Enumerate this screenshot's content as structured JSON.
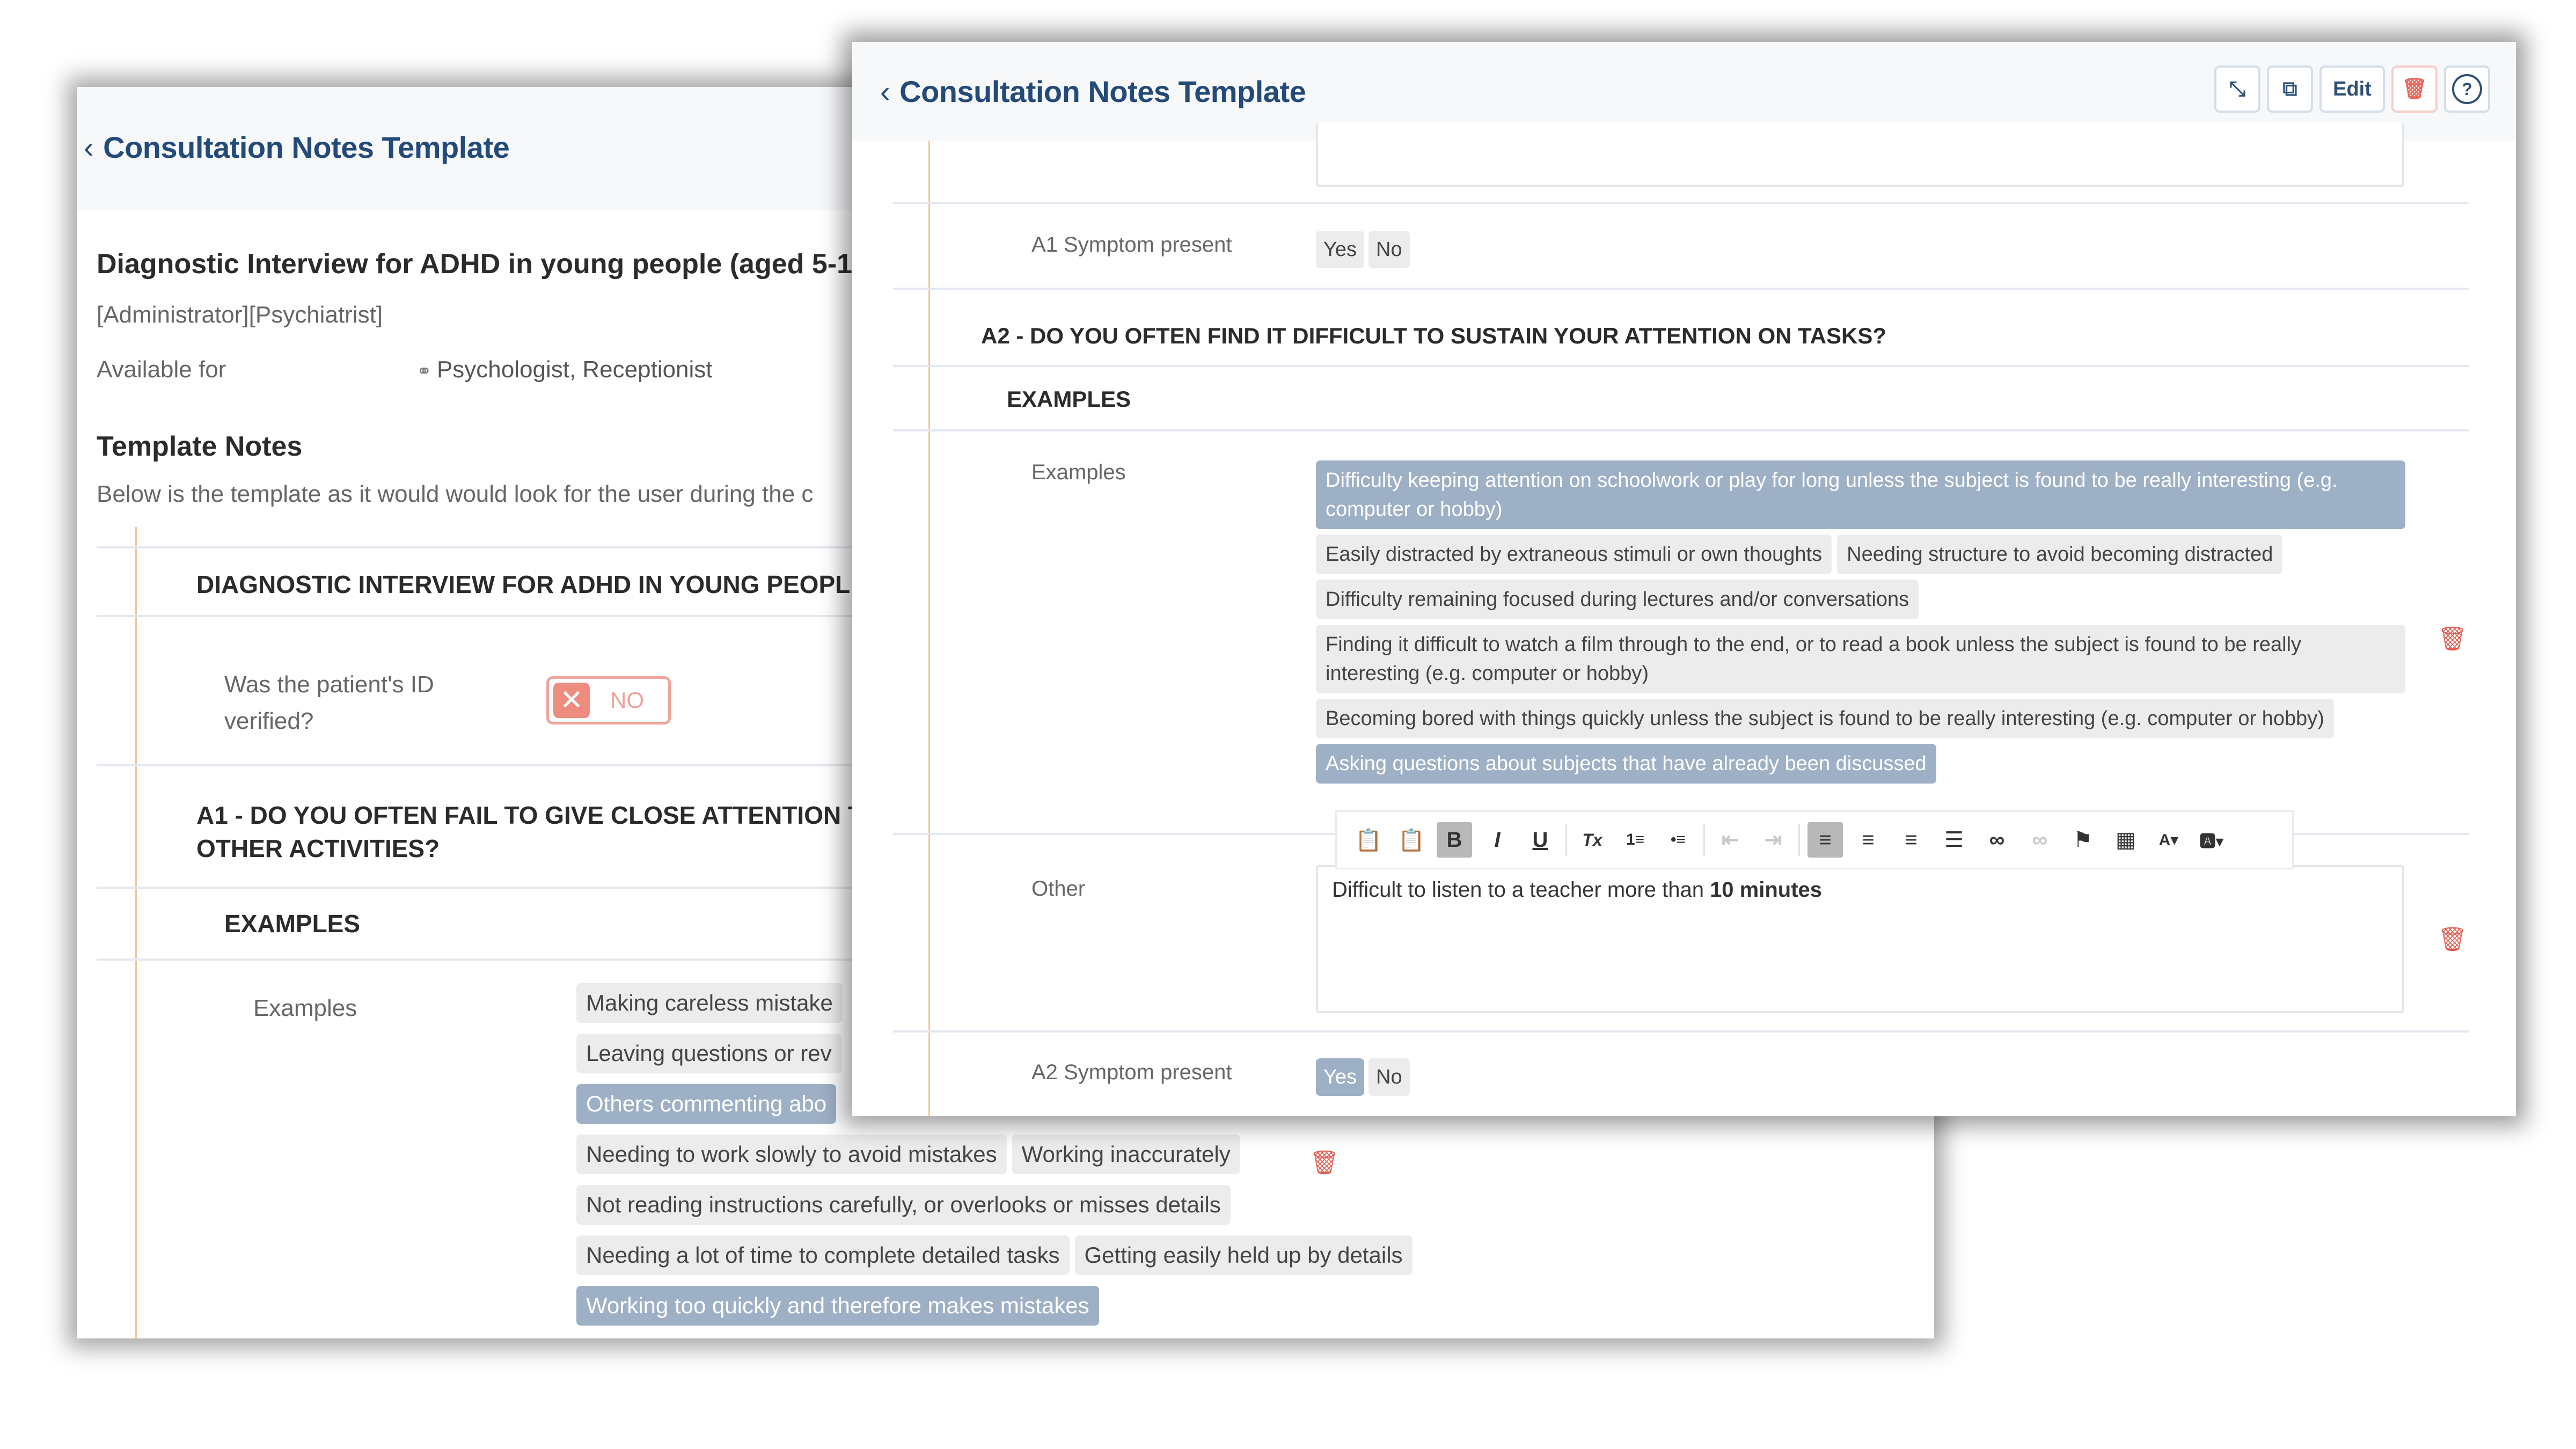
{
  "back_window": {
    "title": "Consultation Notes Template",
    "template_name": "Diagnostic Interview for ADHD in young people (aged 5-1",
    "roles": "[Administrator][Psychiatrist]",
    "available_for_label": "Available for",
    "available_for_value": "Psychologist,  Receptionist",
    "template_notes_heading": "Template Notes",
    "template_notes_desc": "Below is the template as it would would look for the user during the c",
    "section_title": "DIAGNOSTIC INTERVIEW FOR ADHD IN YOUNG PEOPL",
    "id_verified_label": "Was the patient's ID verified?",
    "id_verified_toggle": "NO",
    "a1_question": "A1 - DO YOU OFTEN FAIL TO GIVE CLOSE ATTENTION T",
    "a1_question_line2": "OTHER ACTIVITIES?",
    "examples_heading": "EXAMPLES",
    "examples_label": "Examples",
    "examples": [
      [
        {
          "text": "Making careless mistake",
          "selected": false
        }
      ],
      [
        {
          "text": "Leaving questions or rev",
          "selected": false
        }
      ],
      [
        {
          "text": "Others commenting abo",
          "selected": true
        }
      ],
      [
        {
          "text": "Needing to work slowly to avoid mistakes",
          "selected": false
        },
        {
          "text": "Working inaccurately",
          "selected": false
        }
      ],
      [
        {
          "text": "Not reading instructions carefully, or overlooks or misses details",
          "selected": false
        }
      ],
      [
        {
          "text": "Needing a lot of time to complete detailed tasks",
          "selected": false
        },
        {
          "text": "Getting easily held up by details",
          "selected": false
        }
      ],
      [
        {
          "text": "Working too quickly and therefore makes mistakes",
          "selected": true
        }
      ]
    ]
  },
  "front_window": {
    "title": "Consultation Notes Template",
    "toolbar": {
      "expand_icon": "expand-arrows-icon",
      "duplicate_icon": "copy-window-icon",
      "edit_label": "Edit",
      "delete_icon": "trash-icon",
      "help_icon": "help-circle-icon"
    },
    "a1_symptom_label": "A1 Symptom present",
    "a1_symptom_options": [
      {
        "text": "Yes",
        "selected": false
      },
      {
        "text": "No",
        "selected": false
      }
    ],
    "a2_question": "A2 - DO YOU OFTEN FIND IT DIFFICULT TO SUSTAIN YOUR ATTENTION ON TASKS?",
    "examples_heading": "EXAMPLES",
    "examples_label": "Examples",
    "examples": [
      [
        {
          "text": "Difficulty keeping attention on schoolwork or play for long unless the subject is found to be really interesting (e.g. computer or hobby)",
          "selected": true
        }
      ],
      [
        {
          "text": "Easily distracted by extraneous stimuli or own thoughts",
          "selected": false
        },
        {
          "text": "Needing structure to avoid becoming distracted",
          "selected": false
        }
      ],
      [
        {
          "text": "Difficulty remaining focused during lectures and/or conversations",
          "selected": false
        }
      ],
      [
        {
          "text": "Finding it difficult to watch a film through to the end, or to read a book unless the subject is found to be really interesting (e.g. computer or hobby)",
          "selected": false
        }
      ],
      [
        {
          "text": "Becoming bored with things quickly unless the subject is found to be really interesting (e.g. computer or hobby)",
          "selected": false
        }
      ],
      [
        {
          "text": "Asking questions about subjects that have already been discussed",
          "selected": true
        }
      ]
    ],
    "other_label": "Other",
    "other_text_plain": "Difficult to listen to a teacher more than ",
    "other_text_bold": "10 minutes",
    "editor_toolbar": [
      "paste-icon",
      "paste-text-icon",
      "bold-icon",
      "italic-icon",
      "underline-icon",
      "clear-format-icon",
      "numbered-list-icon",
      "bullet-list-icon",
      "outdent-icon",
      "indent-icon",
      "align-left-icon",
      "align-center-icon",
      "align-right-icon",
      "justify-icon",
      "link-icon",
      "unlink-icon",
      "flag-icon",
      "table-icon",
      "text-color-icon",
      "bg-color-icon"
    ],
    "a2_symptom_label": "A2 Symptom present",
    "a2_symptom_options": [
      {
        "text": "Yes",
        "selected": true
      },
      {
        "text": "No",
        "selected": false
      }
    ]
  },
  "colors": {
    "title_blue": "#234a78",
    "chip_selected": "#9eb0c5",
    "chip_default": "#ececec",
    "danger": "#e8695c",
    "accent_line": "#f4c59a"
  }
}
